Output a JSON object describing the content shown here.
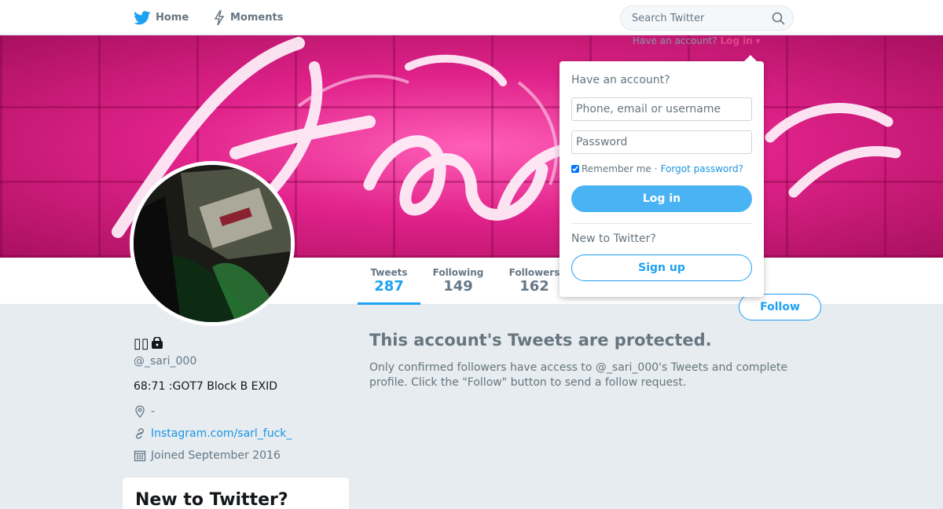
{
  "nav": {
    "home_label": "Home",
    "moments_label": "Moments",
    "search_placeholder": "Search Twitter"
  },
  "header_login": {
    "prompt": "Have an account?",
    "login_label": "Log in"
  },
  "profile_nav": {
    "stats": [
      {
        "label": "Tweets",
        "value": "287"
      },
      {
        "label": "Following",
        "value": "149"
      },
      {
        "label": "Followers",
        "value": "162"
      }
    ],
    "follow_label": "Follow"
  },
  "profile": {
    "name": "▯▯",
    "handle": "@_sari_000",
    "bio": "68:71 :GOT7 Block B EXID",
    "location": "-",
    "url": "Instagram.com/sarl_fuck_",
    "joined": "Joined September 2016"
  },
  "new_card": {
    "title": "New to Twitter?"
  },
  "protected": {
    "title": "This account's Tweets are protected.",
    "body": "Only confirmed followers have access to @_sari_000's Tweets and complete profile. Click the \"Follow\" button to send a follow request."
  },
  "login_dropdown": {
    "heading": "Have an account?",
    "username_placeholder": "Phone, email or username",
    "password_placeholder": "Password",
    "remember_label": "Remember me",
    "remember_checked": true,
    "separator": "·",
    "forgot_label": "Forgot password?",
    "login_button": "Log in",
    "new_heading": "New to Twitter?",
    "signup_button": "Sign up"
  },
  "colors": {
    "accent": "#1da1f2",
    "banner": "#e0228a",
    "background": "#e6ecf0"
  }
}
